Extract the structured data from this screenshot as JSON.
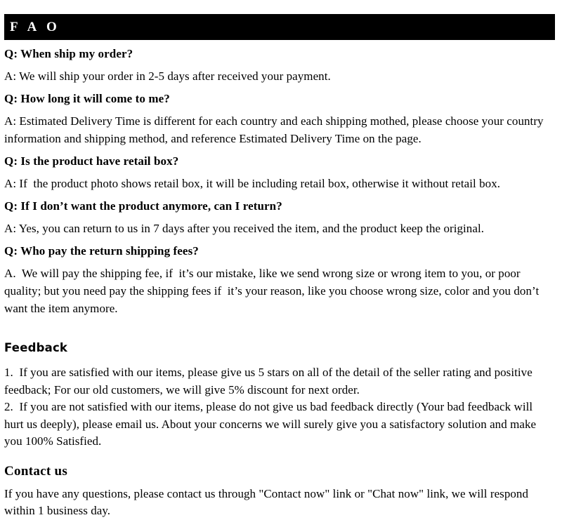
{
  "header": {
    "title": "F A O",
    "background_color": "#000000",
    "text_color": "#ffffff"
  },
  "faq": {
    "items": [
      {
        "question": "Q: When ship my order?",
        "answer": "A: We will ship your order in 2-5 days after received your payment."
      },
      {
        "question": "Q: How long it will come to me?",
        "answer": "A: Estimated Delivery Time is different for each country and each shipping mothed, please choose your country information and shipping method, and reference Estimated Delivery Time on the page."
      },
      {
        "question": "Q: Is the product have retail box?",
        "answer": "A: If  the product photo shows retail box, it will be including retail box, otherwise it without retail box."
      },
      {
        "question": "Q: If  I don’t want the product anymore, can I return?",
        "answer": "A: Yes, you can return to us in 7 days after you received the item, and the product keep the original."
      },
      {
        "question": "Q: Who pay the return shipping fees?",
        "answer": "A.  We will pay the shipping fee, if  it’s our mistake, like we send wrong size or wrong item to you, or poor quality; but you need pay the shipping fees if  it’s your reason, like you choose wrong size, color and you don’t want the item anymore."
      }
    ]
  },
  "feedback": {
    "heading": "Feedback",
    "paragraph": "1.  If you are satisfied with our items, please give us 5 stars on all of the detail of the seller rating and positive feedback; For our old customers, we will give 5% discount for next order.\n2.  If you are not satisfied with our items, please do not give us bad feedback directly (Your bad feedback will hurt us deeply), please email us. About your concerns we will surely give you a satisfactory solution and make you 100% Satisfied."
  },
  "contact": {
    "heading": "Contact us",
    "paragraph": "If you have any questions, please contact us through \"Contact now\" link or \"Chat now\" link, we will respond within 1 business day."
  }
}
